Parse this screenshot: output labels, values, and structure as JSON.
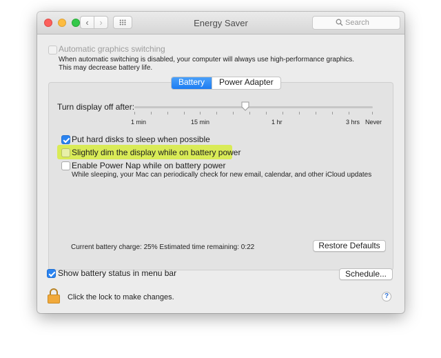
{
  "window": {
    "title": "Energy Saver"
  },
  "toolbar": {
    "back_glyph": "‹",
    "forward_glyph": "›"
  },
  "search": {
    "placeholder": "Search",
    "icon": "search-icon"
  },
  "graphics": {
    "label": "Automatic graphics switching",
    "checked": false,
    "enabled": false,
    "description_line1": "When automatic switching is disabled, your computer will always use high-performance graphics.",
    "description_line2": "This may decrease battery life."
  },
  "tabs": [
    {
      "label": "Battery",
      "active": true
    },
    {
      "label": "Power Adapter",
      "active": false
    }
  ],
  "display_sleep": {
    "label": "Turn display off after:",
    "ticks": [
      "1 min",
      "15 min",
      "1 hr",
      "3 hrs",
      "Never"
    ],
    "value": "between 15 min and 1 hr"
  },
  "options": [
    {
      "label": "Put hard disks to sleep when possible",
      "checked": true
    },
    {
      "label": "Slightly dim the display while on battery power",
      "checked": false,
      "highlighted": true,
      "highlight_color": "#d9eb57"
    },
    {
      "label": "Enable Power Nap while on battery power",
      "checked": false
    }
  ],
  "power_nap_description": "While sleeping, your Mac can periodically check for new email, calendar, and other iCloud updates",
  "status": "Current battery charge: 25%  Estimated time remaining: 0:22",
  "buttons": {
    "restore": "Restore Defaults",
    "schedule": "Schedule..."
  },
  "menu_bar_option": {
    "label": "Show battery status in menu bar",
    "checked": true
  },
  "lock": {
    "text": "Click the lock to make changes.",
    "icon": "lock-icon"
  },
  "help": {
    "glyph": "?"
  },
  "colors": {
    "accent": "#2b84f1",
    "close": "#fc605c",
    "minimize": "#fdbc40",
    "maximize": "#34c84a"
  }
}
